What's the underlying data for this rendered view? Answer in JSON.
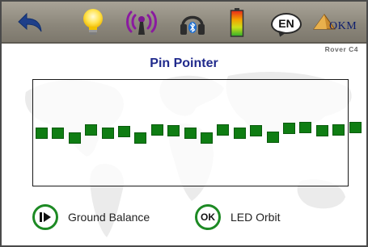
{
  "header": {
    "back_icon": "back-arrow-icon",
    "light_icon": "light-bulb-icon",
    "signal_icon": "antenna-signal-icon",
    "bluetooth_icon": "bluetooth-headphones-icon",
    "battery_icon": "battery-icon",
    "language_label": "EN",
    "brand_name": "OKM",
    "model_name": "Rover C4"
  },
  "main": {
    "title": "Pin Pointer",
    "signal_levels": [
      0.5,
      0.5,
      0.45,
      0.53,
      0.5,
      0.51,
      0.45,
      0.53,
      0.52,
      0.5,
      0.45,
      0.53,
      0.5,
      0.52,
      0.46,
      0.54,
      0.55,
      0.52,
      0.53,
      0.55
    ]
  },
  "footer": {
    "ground_balance_label": "Ground Balance",
    "led_orbit_button_text": "OK",
    "led_orbit_label": "LED Orbit"
  },
  "colors": {
    "accent_green": "#1d8a24",
    "bar_green": "#0f7d13",
    "title_blue": "#202a8c",
    "header_gray": "#8c877b"
  }
}
